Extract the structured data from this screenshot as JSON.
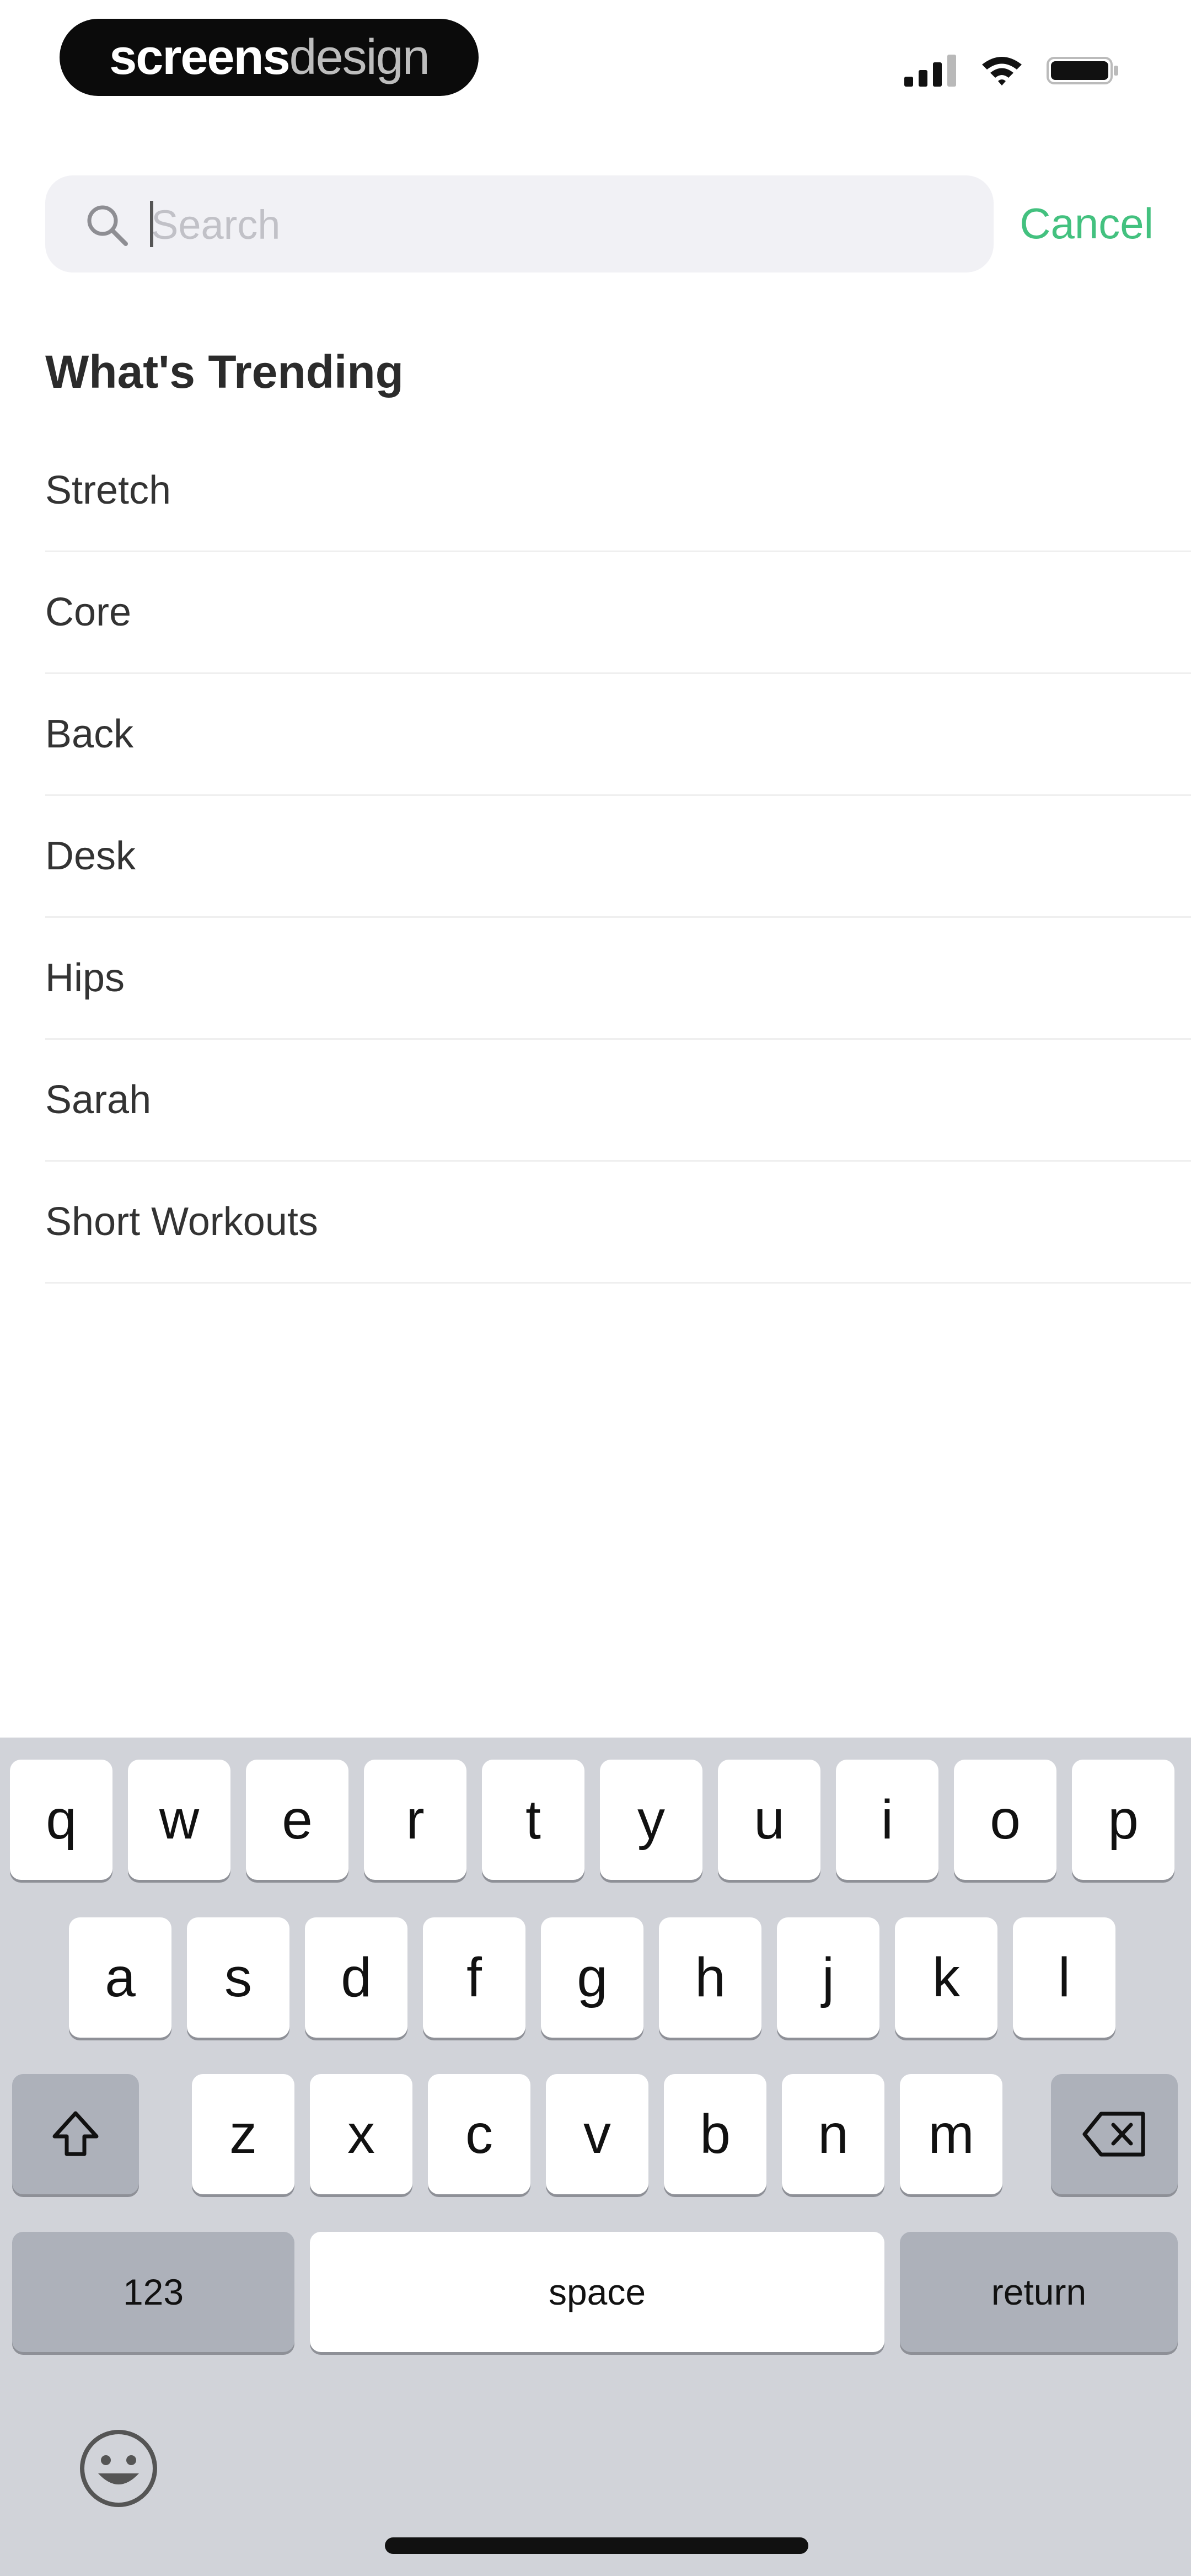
{
  "status_bar": {
    "logo_bold": "screens",
    "logo_light": "design"
  },
  "search": {
    "placeholder": "Search",
    "value": "",
    "cancel_label": "Cancel",
    "accent_color": "#43c17f"
  },
  "trending": {
    "title": "What's Trending",
    "items": [
      {
        "label": "Stretch"
      },
      {
        "label": "Core"
      },
      {
        "label": "Back"
      },
      {
        "label": "Desk"
      },
      {
        "label": "Hips"
      },
      {
        "label": "Sarah"
      },
      {
        "label": "Short Workouts"
      }
    ]
  },
  "keyboard": {
    "row1": [
      "q",
      "w",
      "e",
      "r",
      "t",
      "y",
      "u",
      "i",
      "o",
      "p"
    ],
    "row2": [
      "a",
      "s",
      "d",
      "f",
      "g",
      "h",
      "j",
      "k",
      "l"
    ],
    "row3": [
      "z",
      "x",
      "c",
      "v",
      "b",
      "n",
      "m"
    ],
    "numbers_label": "123",
    "space_label": "space",
    "return_label": "return",
    "shift_icon": "shift-arrow-icon",
    "delete_icon": "backspace-icon",
    "emoji_icon": "emoji-smiley-icon"
  }
}
